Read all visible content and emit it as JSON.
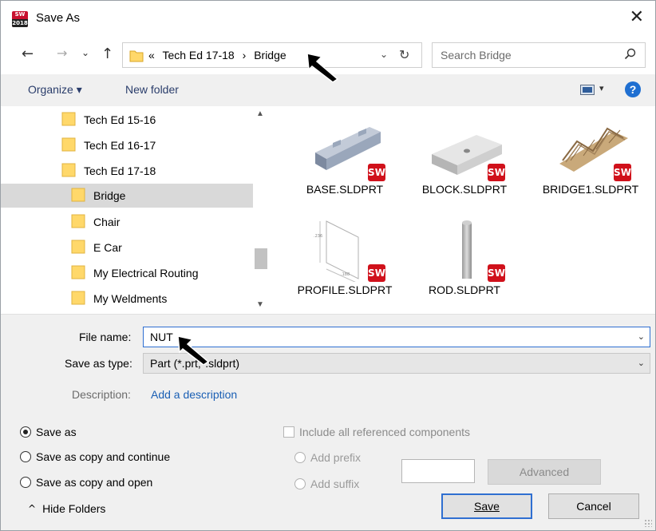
{
  "window": {
    "title": "Save As",
    "app_icon_top": "SW",
    "app_icon_bottom": "2018"
  },
  "nav": {
    "back": "←",
    "forward": "→",
    "recent": "⌄",
    "up": "↑",
    "breadcrumb": [
      "«",
      "Tech Ed 17-18",
      "›",
      "Bridge"
    ],
    "address_dropdown": "⌄",
    "refresh": "↻",
    "search_placeholder": "Search Bridge"
  },
  "toolbar": {
    "organize": "Organize ▾",
    "new_folder": "New folder",
    "view_dropdown": "▾",
    "help": "?"
  },
  "tree": {
    "items": [
      {
        "label": "Tech Ed 15-16",
        "selected": false
      },
      {
        "label": "Tech Ed 16-17",
        "selected": false
      },
      {
        "label": "Tech Ed 17-18",
        "selected": false
      },
      {
        "label": "Bridge",
        "selected": true
      },
      {
        "label": "Chair",
        "selected": false
      },
      {
        "label": "E Car",
        "selected": false
      },
      {
        "label": "My Electrical Routing",
        "selected": false
      },
      {
        "label": "My Weldments",
        "selected": false
      }
    ]
  },
  "files": [
    {
      "name": "BASE.SLDPRT",
      "badge": "SW"
    },
    {
      "name": "BLOCK.SLDPRT",
      "badge": "SW"
    },
    {
      "name": "BRIDGE1.SLDPRT",
      "badge": "SW"
    },
    {
      "name": "PROFILE.SLDPRT",
      "badge": "SW"
    },
    {
      "name": "ROD.SLDPRT",
      "badge": "SW"
    }
  ],
  "form": {
    "file_name_label": "File name:",
    "file_name_value": "NUT",
    "save_type_label": "Save as type:",
    "save_type_value": "Part (*.prt;*.sldprt)",
    "description_label": "Description:",
    "description_link": "Add a description",
    "save_options": [
      {
        "label": "Save as",
        "checked": true
      },
      {
        "label": "Save as copy and continue",
        "checked": false
      },
      {
        "label": "Save as copy and open",
        "checked": false
      }
    ],
    "include_refs_label": "Include all referenced components",
    "add_prefix_label": "Add prefix",
    "add_suffix_label": "Add suffix",
    "advanced_button": "Advanced",
    "save_button": "Save",
    "cancel_button": "Cancel",
    "hide_folders": "Hide Folders",
    "hide_folders_icon": "^"
  },
  "colors": {
    "selection": "#d9d9d9",
    "folder": "#ffd86a",
    "accent": "#2f6fd1",
    "sw_badge": "#d0111b"
  }
}
